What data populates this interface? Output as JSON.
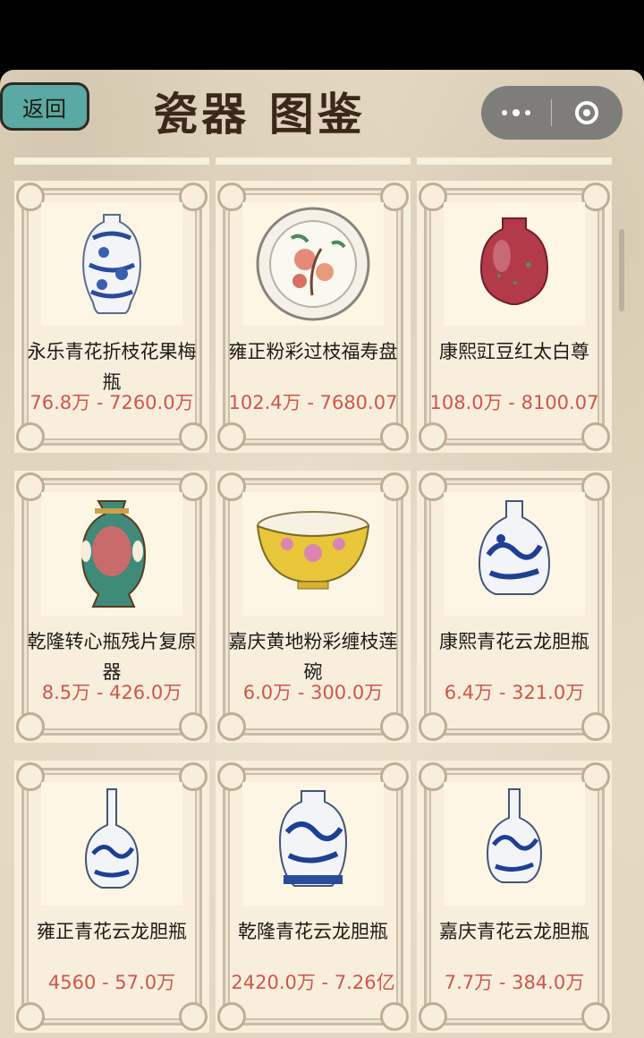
{
  "header": {
    "back_label": "返回",
    "title": "瓷器 图鉴"
  },
  "items": [
    {
      "name": "永乐青花折枝花果梅瓶",
      "price": "76.8万 - 7260.0万"
    },
    {
      "name": "雍正粉彩过枝福寿盘",
      "price": "102.4万 - 7680.07"
    },
    {
      "name": "康熙豇豆红太白尊",
      "price": "108.0万 - 8100.07"
    },
    {
      "name": "乾隆转心瓶残片复原器",
      "price": "8.5万 - 426.0万"
    },
    {
      "name": "嘉庆黄地粉彩缠枝莲碗",
      "price": "6.0万 - 300.0万"
    },
    {
      "name": "康熙青花云龙胆瓶",
      "price": "6.4万 - 321.0万"
    },
    {
      "name": "雍正青花云龙胆瓶",
      "price": "4560 - 57.0万"
    },
    {
      "name": "乾隆青花云龙胆瓶",
      "price": "2420.0万 - 7.26亿"
    },
    {
      "name": "嘉庆青花云龙胆瓶",
      "price": "7.7万 - 384.0万"
    }
  ],
  "icons": {
    "more": "more-dots-icon",
    "close": "target-circle-icon"
  },
  "colors": {
    "back_button": "#5aa9a2",
    "price": "#d1554a",
    "title": "#3b2818"
  }
}
